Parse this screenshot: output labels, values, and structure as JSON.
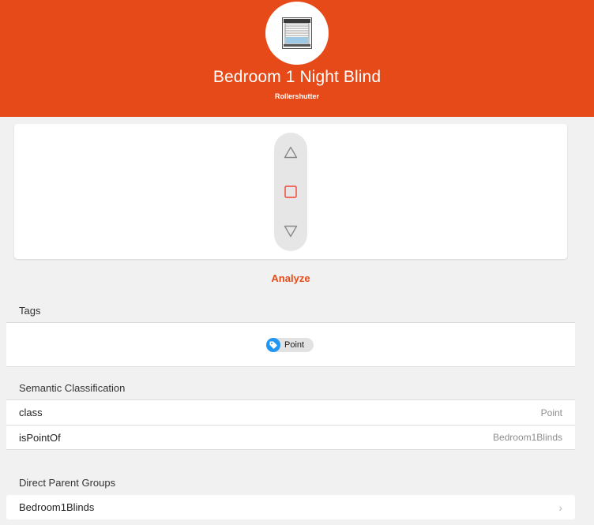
{
  "header": {
    "title": "Bedroom 1 Night Blind",
    "subtitle": "Rollershutter",
    "avatar_icon": "rollershutter-icon",
    "background_color": "#e64a19"
  },
  "control": {
    "up_icon": "triangle-up-icon",
    "stop_icon": "square-stop-icon",
    "down_icon": "triangle-down-icon",
    "stop_color": "#f44336"
  },
  "analyze_label": "Analyze",
  "tags": {
    "title": "Tags",
    "items": [
      {
        "label": "Point",
        "icon": "tag-icon",
        "color": "#2196f3"
      }
    ]
  },
  "semantic": {
    "title": "Semantic Classification",
    "rows": [
      {
        "key": "class",
        "value": "Point"
      },
      {
        "key": "isPointOf",
        "value": "Bedroom1Blinds"
      }
    ]
  },
  "parents": {
    "title": "Direct Parent Groups",
    "items": [
      {
        "label": "Bedroom1Blinds"
      }
    ]
  }
}
